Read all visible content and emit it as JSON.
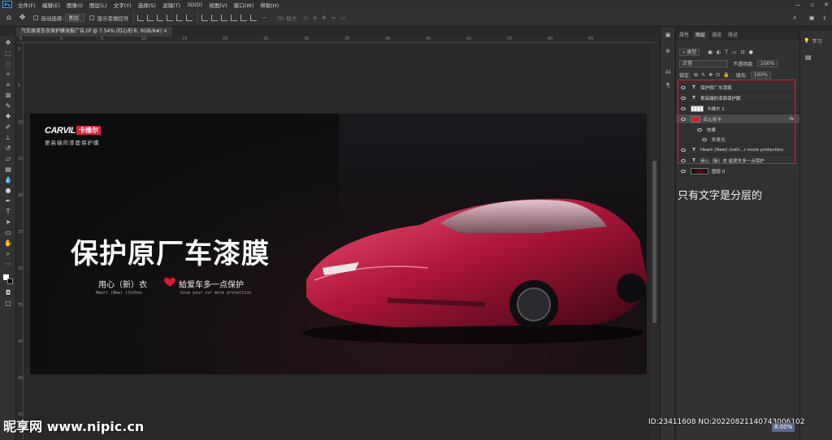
{
  "menubar": {
    "logo": "Ps",
    "items": [
      "文件(F)",
      "编辑(E)",
      "图像(I)",
      "图层(L)",
      "文字(Y)",
      "选择(S)",
      "滤镜(T)",
      "3D(D)",
      "视图(V)",
      "窗口(W)",
      "帮助(H)"
    ],
    "window_controls": [
      "—",
      "▫",
      "✕"
    ]
  },
  "options": {
    "auto_select_label": "自动选择:",
    "auto_select_value": "图层",
    "show_transform_label": "显示变换控件",
    "mode_3d_label": "3D 模式:"
  },
  "document": {
    "tab_title": "汽车原漆车衣保护膜海报广告.tif @ 7.54% (红心形卡, RGB/8#)"
  },
  "ruler": {
    "top_ticks": [
      "5",
      "0",
      "5",
      "10",
      "15",
      "20",
      "25",
      "30",
      "35",
      "40",
      "45",
      "50",
      "55",
      "60",
      "65"
    ],
    "left_ticks": [
      "0",
      "5",
      "10",
      "15",
      "20",
      "25",
      "30",
      "35",
      "40",
      "45",
      "50"
    ]
  },
  "artwork": {
    "brand_en": "CARVIL",
    "brand_cn": "卡维尔",
    "tagline": "更高端的漆面保护膜",
    "headline": "保护原厂车漆膜",
    "sub_left": "用心（新）衣",
    "sub_right": "給爱车多一点保护",
    "eng_left": "Heart (New) clothes",
    "eng_right": "Give your car more protection",
    "colors": {
      "brand_red": "#d9233c",
      "heart_red": "#e0182d"
    }
  },
  "layers_panel": {
    "tabs": [
      "属性",
      "图层",
      "通道",
      "路径"
    ],
    "active_tab": "图层",
    "filter_label": "类型",
    "blend_mode": "正常",
    "opacity_label": "不透明度:",
    "opacity_value": "100%",
    "lock_label": "锁定:",
    "fill_label": "填充:",
    "fill_value": "100%",
    "layers": [
      {
        "type": "T",
        "name": "保护原厂车漆膜"
      },
      {
        "type": "T",
        "name": "更高端的漆面保护膜"
      },
      {
        "type": "img",
        "name": "卡维尔 1"
      },
      {
        "type": "shape",
        "name": "红心形卡",
        "fx": "fx",
        "selected": true
      },
      {
        "type": "effect",
        "name": "效果"
      },
      {
        "type": "effect2",
        "name": "外发光"
      },
      {
        "type": "T",
        "name": "Heart (New) cloth...r more protection"
      },
      {
        "type": "T",
        "name": "用心（新）衣      給爱车多一点保护"
      },
      {
        "type": "img",
        "name": "图层 0"
      }
    ]
  },
  "annotation": "只有文字是分层的",
  "learn_panel": {
    "label": "学习"
  },
  "watermark": {
    "site": "昵享网 www.nipic.cn",
    "id_text": "ID:23411608 NO:20220821140743006102",
    "zoom": "8.00%"
  }
}
